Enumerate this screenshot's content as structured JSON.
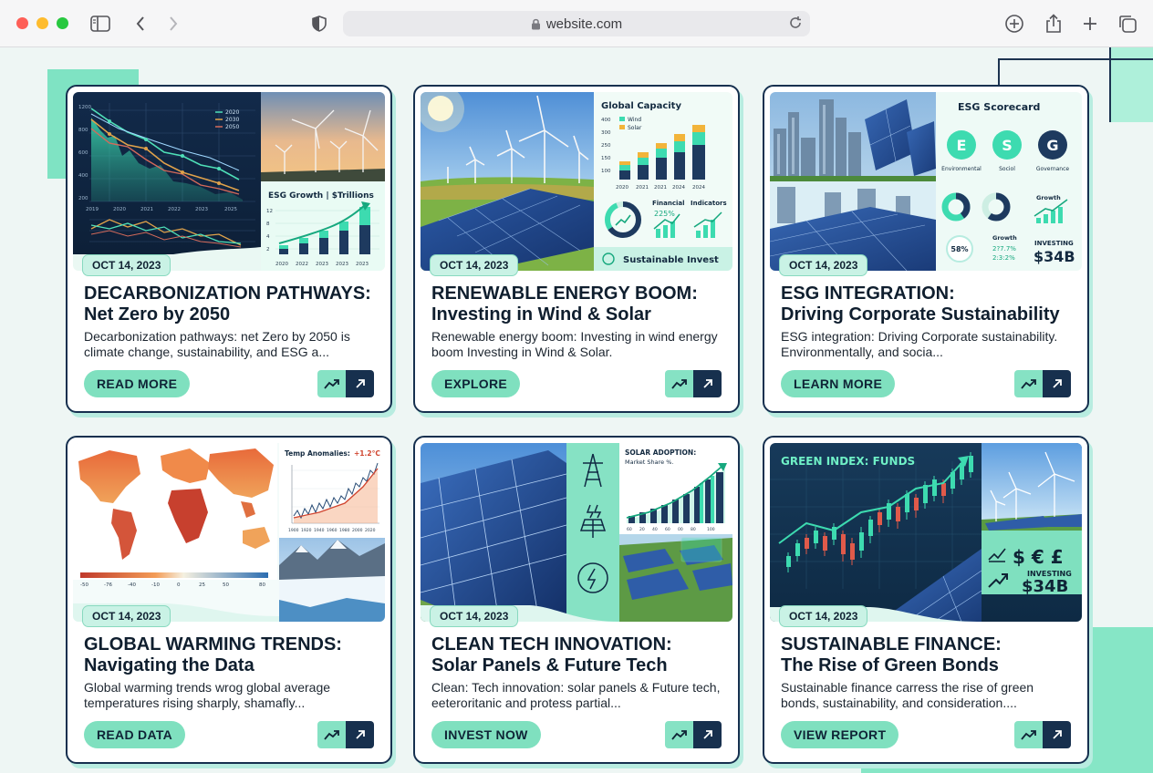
{
  "browser": {
    "url": "website.com",
    "icons": [
      "sidebar-icon",
      "back-icon",
      "forward-icon",
      "shield-icon",
      "lock-icon",
      "reload-icon",
      "download-icon",
      "share-icon",
      "new-tab-icon",
      "tabs-icon"
    ]
  },
  "colors": {
    "accent": "#7fe0bf",
    "navy": "#17304e",
    "background": "#eef6f4"
  },
  "cards": [
    {
      "date": "OCT 14, 2023",
      "title_line1": "DECARBONIZATION PATHWAYS:",
      "title_line2": "Net Zero by 2050",
      "excerpt": "Decarbonization pathways: net Zero by 2050 is climate change, sustainability, and ESG a...",
      "cta": "READ MORE",
      "image": {
        "legend": [
          "2020",
          "2030",
          "2050"
        ],
        "top_years": [
          "2019",
          "2020",
          "2021",
          "2022",
          "2023",
          "2025"
        ],
        "panel_title": "ESG Growth | $Trillions",
        "panel_years": [
          "2020",
          "2022",
          "2023",
          "2023",
          "2023"
        ]
      }
    },
    {
      "date": "OCT 14, 2023",
      "title_line1": "RENEWABLE ENERGY BOOM:",
      "title_line2": "Investing in Wind & Solar",
      "excerpt": "Renewable energy boom: Investing in wind energy boom Investing in Wind & Solar.",
      "cta": "EXPLORE",
      "image": {
        "panel_title": "Global Capacity",
        "legend": [
          "Wind",
          "Solar"
        ],
        "years": [
          "2020",
          "2021",
          "2021",
          "2024",
          "2024"
        ],
        "labels": [
          "Financial",
          "Indicators"
        ],
        "percent": "225%",
        "footer": "Sustainable Invest"
      }
    },
    {
      "date": "OCT 14, 2023",
      "title_line1": "ESG INTEGRATION:",
      "title_line2": "Driving Corporate Sustainability",
      "excerpt": "ESG integration: Driving Corporate sustainability. Environmentally, and socia...",
      "cta": "LEARN MORE",
      "image": {
        "panel_title": "ESG Scorecard",
        "letters": [
          "E",
          "S",
          "G"
        ],
        "letter_labels": [
          "Environmental",
          "Sociol",
          "Governance"
        ],
        "growth": "Growth",
        "growth2": "Growth",
        "growth_values": "2?7.7%",
        "growth_values2": "2:3:2%",
        "pct": "58%",
        "investing": "INVESTING",
        "amount": "$34B"
      }
    },
    {
      "date": "OCT 14, 2023",
      "title_line1": "GLOBAL WARMING TRENDS:",
      "title_line2": "Navigating the Data",
      "excerpt": "Global warming trends wrog global average temperatures rising sharply, shamafly...",
      "cta": "READ DATA",
      "image": {
        "chart_title": "Temp Anomalies:",
        "chart_value": "+1.2°C",
        "chart_ticks": [
          "1900",
          "1920",
          "1940",
          "1960",
          "1980",
          "2000",
          "2020"
        ],
        "scale_ticks": [
          "-50",
          "-76",
          "-40",
          "-10",
          "0",
          "25",
          "50",
          "80"
        ]
      }
    },
    {
      "date": "OCT 14, 2023",
      "title_line1": "CLEAN TECH INNOVATION:",
      "title_line2": "Solar Panels & Future Tech",
      "excerpt": "Clean: Tech innovation: solar panels & Future tech, eeteroritanic and protess partial...",
      "cta": "INVEST NOW",
      "image": {
        "chart_title": "SOLAR ADOPTION:",
        "chart_subtitle": "Market Share %.",
        "chart_ticks": [
          "60",
          "20",
          "40",
          "60",
          "00",
          "80",
          "100"
        ],
        "icons": [
          "power-tower-icon",
          "solar-panel-icon",
          "energy-bolt-icon"
        ]
      }
    },
    {
      "date": "OCT 14, 2023",
      "title_line1": "SUSTAINABLE FINANCE:",
      "title_line2": "The Rise of Green Bonds",
      "excerpt": "Sustainable finance carress the rise of green bonds, sustainability, and consideration....",
      "cta": "VIEW REPORT",
      "image": {
        "chart_title": "GREEN INDEX: FUNDS",
        "currencies": "$ € £",
        "investing": "INVESTING",
        "amount": "$34B"
      }
    }
  ]
}
